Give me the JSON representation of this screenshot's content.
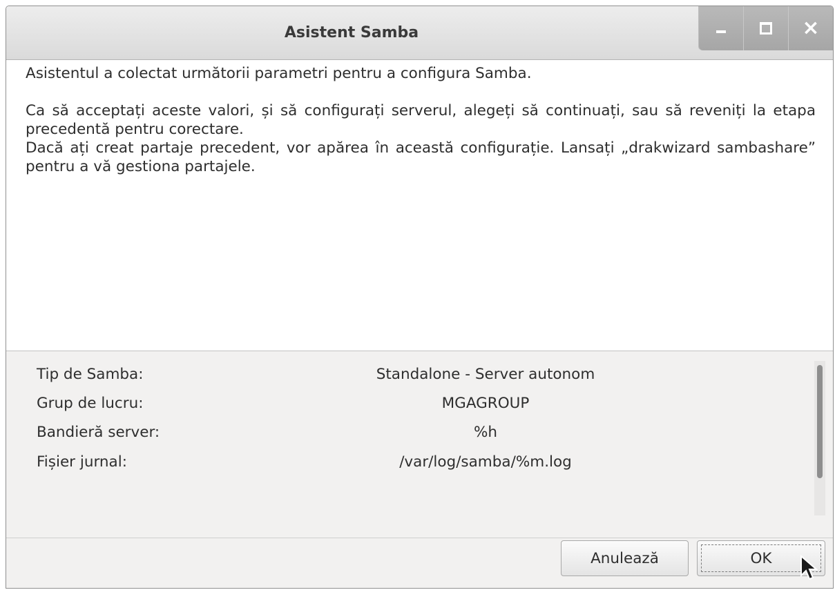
{
  "window": {
    "title": "Asistent Samba"
  },
  "message": {
    "line1": "Asistentul a colectat următorii parametri pentru a configura Samba.",
    "line2": "Ca să acceptați aceste valori, și să configurați serverul, alegeți să continuați, sau să reveniți la etapa precedentă pentru corectare.",
    "line3": "Dacă ați creat partaje precedent, vor apărea în această configurație. Lansați „drakwizard sambashare” pentru a vă gestiona partajele."
  },
  "params": [
    {
      "label": "Tip de Samba:",
      "value": "Standalone - Server autonom"
    },
    {
      "label": "Grup de lucru:",
      "value": "MGAGROUP"
    },
    {
      "label": "Bandieră server:",
      "value": "%h"
    },
    {
      "label": "Fișier jurnal:",
      "value": "/var/log/samba/%m.log"
    }
  ],
  "buttons": {
    "cancel": "Anulează",
    "ok": "OK"
  },
  "icons": {
    "minimize": "minimize-icon",
    "maximize": "maximize-icon",
    "close": "close-icon",
    "cursor": "mouse-pointer-icon"
  }
}
